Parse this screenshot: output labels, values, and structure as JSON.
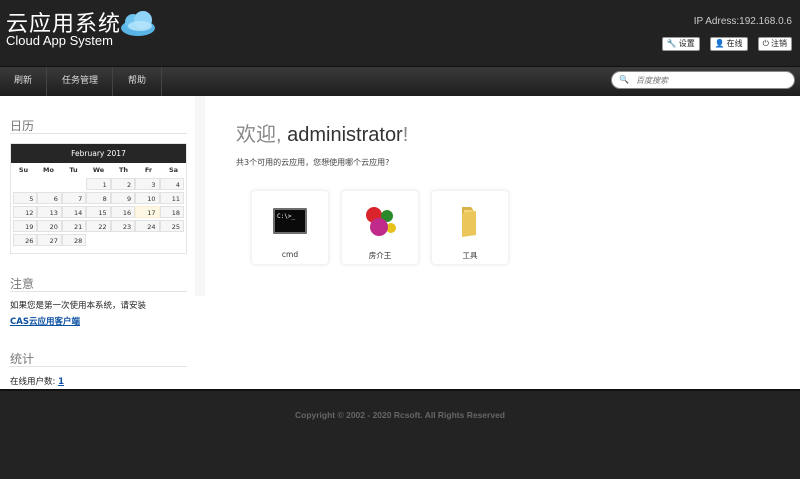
{
  "header": {
    "logo_cn": "云应用系统",
    "logo_en": "Cloud App System",
    "ip": "IP Adress:192.168.0.6",
    "buttons": {
      "settings": "设置",
      "online": "在线",
      "logout": "注销"
    }
  },
  "nav": {
    "items": [
      "刷新",
      "任务管理",
      "帮助"
    ],
    "search_placeholder": "百度搜索"
  },
  "sidebar": {
    "calendar_title": "日历",
    "calendar": {
      "month": "February 2017",
      "dow": [
        "Su",
        "Mo",
        "Tu",
        "We",
        "Th",
        "Fr",
        "Sa"
      ],
      "days": [
        "",
        "",
        "",
        "1",
        "2",
        "3",
        "4",
        "5",
        "6",
        "7",
        "8",
        "9",
        "10",
        "11",
        "12",
        "13",
        "14",
        "15",
        "16",
        "17",
        "18",
        "19",
        "20",
        "21",
        "22",
        "23",
        "24",
        "25",
        "26",
        "27",
        "28",
        "",
        "",
        "",
        ""
      ],
      "today": "17"
    },
    "notice_title": "注意",
    "notice_text": "如果您是第一次使用本系统，请安装",
    "notice_link": "CAS云应用客户端",
    "stats_title": "统计",
    "online_label": "在线用户数:",
    "online_count": "1"
  },
  "main": {
    "welcome_prefix": "欢迎, ",
    "welcome_user": "administrator",
    "welcome_suffix": "!",
    "subtitle": "共3个可用的云应用，您想使用哪个云应用?",
    "apps": [
      {
        "label": "cmd",
        "icon": "cmd-icon"
      },
      {
        "label": "房介王",
        "icon": "app-balls-icon"
      },
      {
        "label": "工具",
        "icon": "folder-icon"
      }
    ]
  },
  "footer": {
    "copyright": "Copyright © 2002 - 2020 Rcsoft. All Rights Reserved"
  }
}
